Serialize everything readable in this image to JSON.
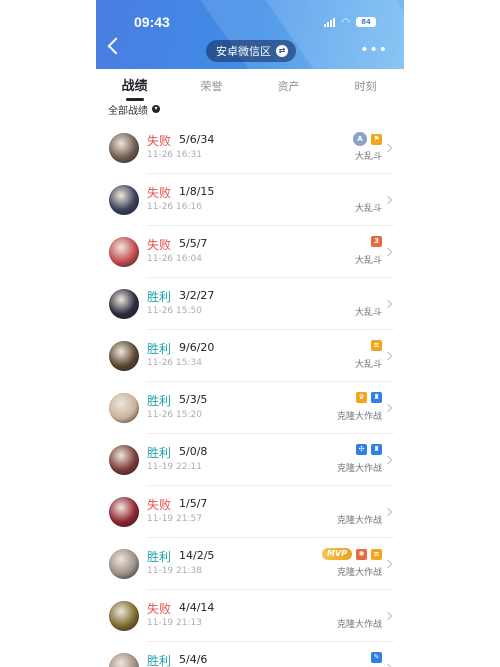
{
  "status_bar": {
    "time": "09:43",
    "battery": "84"
  },
  "nav": {
    "group_name": "安卓微信区",
    "swap_glyph": "⇄",
    "more": "•••"
  },
  "tabs": [
    {
      "label": "战绩",
      "active": true
    },
    {
      "label": "荣誉",
      "active": false
    },
    {
      "label": "资产",
      "active": false
    },
    {
      "label": "时刻",
      "active": false
    }
  ],
  "filter": {
    "label": "全部战绩",
    "caret": "▾"
  },
  "matches": [
    {
      "result": "失败",
      "outcome": "lose",
      "kda": "5/6/34",
      "time": "11-26 16:31",
      "mode": "大乱斗",
      "badges": [
        {
          "type": "circle",
          "text": "A"
        },
        {
          "type": "orange",
          "text": "⚑"
        }
      ],
      "avatar_color": "#6e5a4e"
    },
    {
      "result": "失败",
      "outcome": "lose",
      "kda": "1/8/15",
      "time": "11-26 16:16",
      "mode": "大乱斗",
      "badges": [],
      "avatar_color": "#3a3f57"
    },
    {
      "result": "失败",
      "outcome": "lose",
      "kda": "5/5/7",
      "time": "11-26 16:04",
      "mode": "大乱斗",
      "badges": [
        {
          "type": "red",
          "text": "3"
        }
      ],
      "avatar_color": "#c04c4c"
    },
    {
      "result": "胜利",
      "outcome": "win",
      "kda": "3/2/27",
      "time": "11-26 15:50",
      "mode": "大乱斗",
      "badges": [],
      "avatar_color": "#2a2c3f"
    },
    {
      "result": "胜利",
      "outcome": "win",
      "kda": "9/6/20",
      "time": "11-26 15:34",
      "mode": "大乱斗",
      "badges": [
        {
          "type": "orange",
          "text": "≡"
        }
      ],
      "avatar_color": "#5a4630"
    },
    {
      "result": "胜利",
      "outcome": "win",
      "kda": "5/3/5",
      "time": "11-26 15:20",
      "mode": "克隆大作战",
      "badges": [
        {
          "type": "orange",
          "text": "♛"
        },
        {
          "type": "blue",
          "text": "♜"
        }
      ],
      "avatar_color": "#c8b49a"
    },
    {
      "result": "胜利",
      "outcome": "win",
      "kda": "5/0/8",
      "time": "11-19 22:11",
      "mode": "克隆大作战",
      "badges": [
        {
          "type": "blue",
          "text": "✣"
        },
        {
          "type": "blue",
          "text": "♜"
        }
      ],
      "avatar_color": "#7a3b35"
    },
    {
      "result": "失败",
      "outcome": "lose",
      "kda": "1/5/7",
      "time": "11-19 21:57",
      "mode": "克隆大作战",
      "badges": [],
      "avatar_color": "#8e2430"
    },
    {
      "result": "胜利",
      "outcome": "win",
      "kda": "14/2/5",
      "time": "11-19 21:38",
      "mode": "克隆大作战",
      "badges": [
        {
          "type": "mvp",
          "text": "MVP"
        },
        {
          "type": "red",
          "text": "✺"
        },
        {
          "type": "orange",
          "text": "≡"
        }
      ],
      "avatar_color": "#9a8f86"
    },
    {
      "result": "失败",
      "outcome": "lose",
      "kda": "4/4/14",
      "time": "11-19 21:13",
      "mode": "克隆大作战",
      "badges": [],
      "avatar_color": "#7b6b2c"
    },
    {
      "result": "胜利",
      "outcome": "win",
      "kda": "5/4/6",
      "time": "",
      "mode": "",
      "badges": [
        {
          "type": "blue",
          "text": "✎"
        }
      ],
      "avatar_color": "#a08e80"
    }
  ],
  "colors": {
    "win": "#21a2a6",
    "lose": "#e5514f",
    "header_blue": "#4a7de0"
  }
}
